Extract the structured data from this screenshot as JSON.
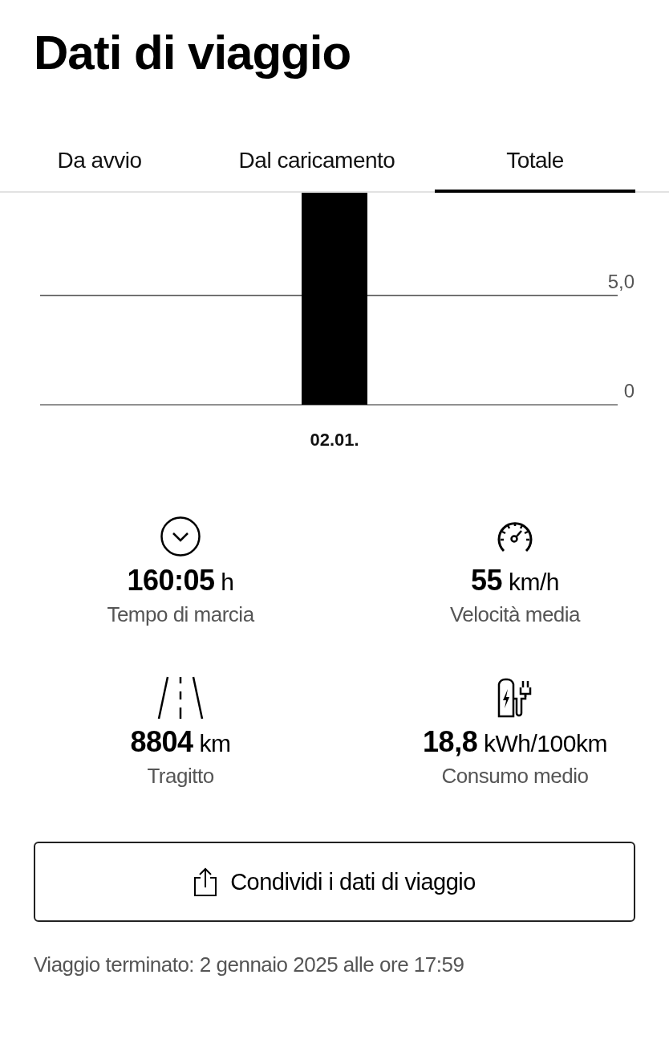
{
  "title": "Dati di viaggio",
  "tabs": [
    {
      "label": "Da avvio",
      "selected": false
    },
    {
      "label": "Dal caricamento",
      "selected": false
    },
    {
      "label": "Totale",
      "selected": true
    }
  ],
  "chart_data": {
    "type": "bar",
    "categories": [
      "02.01."
    ],
    "values": [
      9.7
    ],
    "ylim": [
      0,
      9.7
    ],
    "yticks": [
      {
        "value": 0,
        "label": "0"
      },
      {
        "value": 5,
        "label": "5,0"
      }
    ]
  },
  "stats": [
    {
      "value": "160:05",
      "unit": "h",
      "label": "Tempo di marcia"
    },
    {
      "value": "55",
      "unit": "km/h",
      "label": "Velocità media"
    },
    {
      "value": "8804",
      "unit": "km",
      "label": "Tragitto"
    },
    {
      "value": "18,8",
      "unit": "kWh/100km",
      "label": "Consumo medio"
    }
  ],
  "share_button": "Condividi i dati di viaggio",
  "footer": "Viaggio terminato: 2 gennaio 2025 alle ore 17:59"
}
